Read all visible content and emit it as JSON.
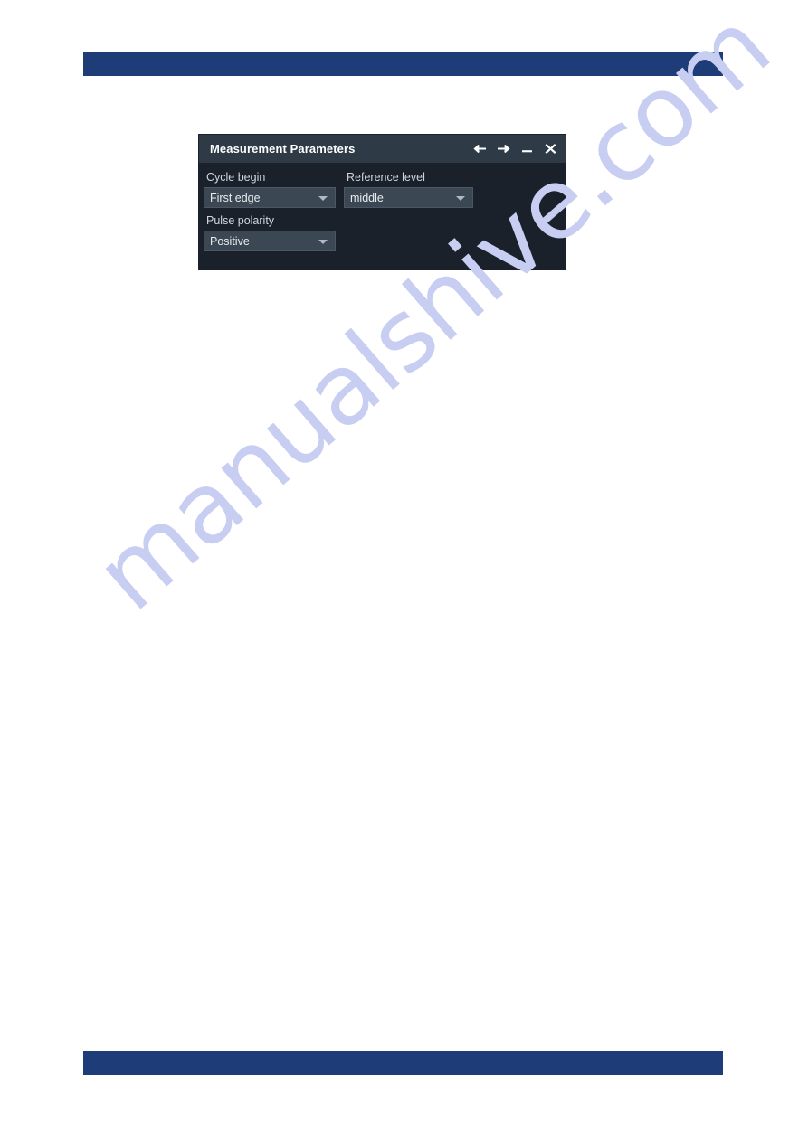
{
  "page": {
    "background_color": "#ffffff",
    "banner_color": "#1d3c78"
  },
  "watermark": {
    "text": "manualshive.com",
    "color": "#c8cdf2"
  },
  "dialog": {
    "title": "Measurement Parameters",
    "background_color": "#1b212b",
    "titlebar_color": "#2e3b47",
    "titlebar_buttons": [
      {
        "name": "back-arrow-icon",
        "label": "Back"
      },
      {
        "name": "forward-arrow-icon",
        "label": "Forward"
      },
      {
        "name": "minimize-icon",
        "label": "Minimize"
      },
      {
        "name": "close-icon",
        "label": "Close"
      }
    ],
    "fields": [
      {
        "id": "cycle-begin",
        "label": "Cycle begin",
        "value": "First edge"
      },
      {
        "id": "reference-level",
        "label": "Reference level",
        "value": "middle"
      },
      {
        "id": "pulse-polarity",
        "label": "Pulse polarity",
        "value": "Positive"
      }
    ]
  }
}
